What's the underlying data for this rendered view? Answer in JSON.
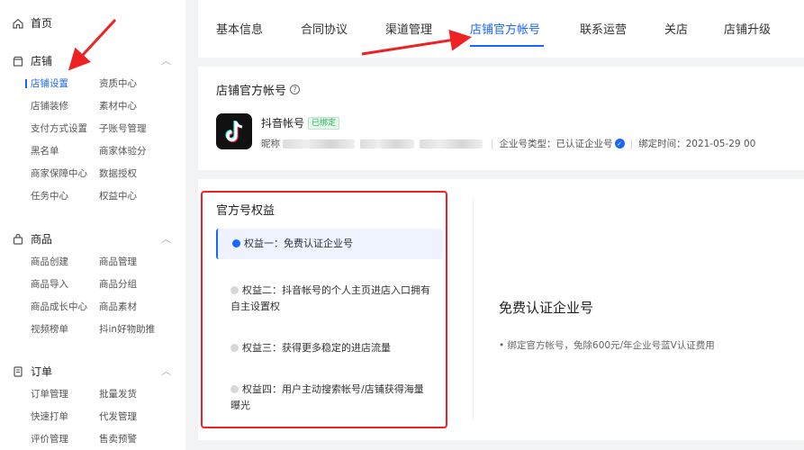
{
  "sidebar": {
    "home": {
      "icon": "home-icon",
      "label": "首页"
    },
    "sections": [
      {
        "icon": "store-icon",
        "label": "店铺",
        "items": [
          "店铺设置",
          "资质中心",
          "店铺装修",
          "素材中心",
          "支付方式设置",
          "子账号管理",
          "黑名单",
          "商家体验分",
          "商家保障中心",
          "数据授权",
          "任务中心",
          "权益中心"
        ]
      },
      {
        "icon": "bag-icon",
        "label": "商品",
        "items": [
          "商品创建",
          "商品管理",
          "商品导入",
          "商品分组",
          "商品成长中心",
          "商品素材",
          "视频榜单",
          "抖in好物助推"
        ]
      },
      {
        "icon": "order-icon",
        "label": "订单",
        "items": [
          "订单管理",
          "批量发货",
          "快速打单",
          "代发管理",
          "评价管理",
          "售卖预警"
        ]
      }
    ]
  },
  "tabs": [
    "基本信息",
    "合同协议",
    "渠道管理",
    "店铺官方帐号",
    "联系运营",
    "关店",
    "店铺升级"
  ],
  "account": {
    "title": "店铺官方帐号",
    "name": "抖音帐号",
    "badge": "已绑定",
    "nickname_label": "昵称",
    "type_text": "企业号类型：已认证企业号",
    "bind_time": "绑定时间：2021-05-29 00"
  },
  "benefits": {
    "title": "官方号权益",
    "items": [
      "权益一：免费认证企业号",
      "权益二：抖音帐号的个人主页进店入口拥有自主设置权",
      "权益三：获得更多稳定的进店流量",
      "权益四：用户主动搜索帐号/店铺获得海量曝光"
    ],
    "detail_title": "免费认证企业号",
    "detail_desc": "• 绑定官方帐号，免除600元/年企业号蓝V认证费用"
  },
  "colors": {
    "accent": "#1966ff",
    "annotation": "#e22222"
  }
}
